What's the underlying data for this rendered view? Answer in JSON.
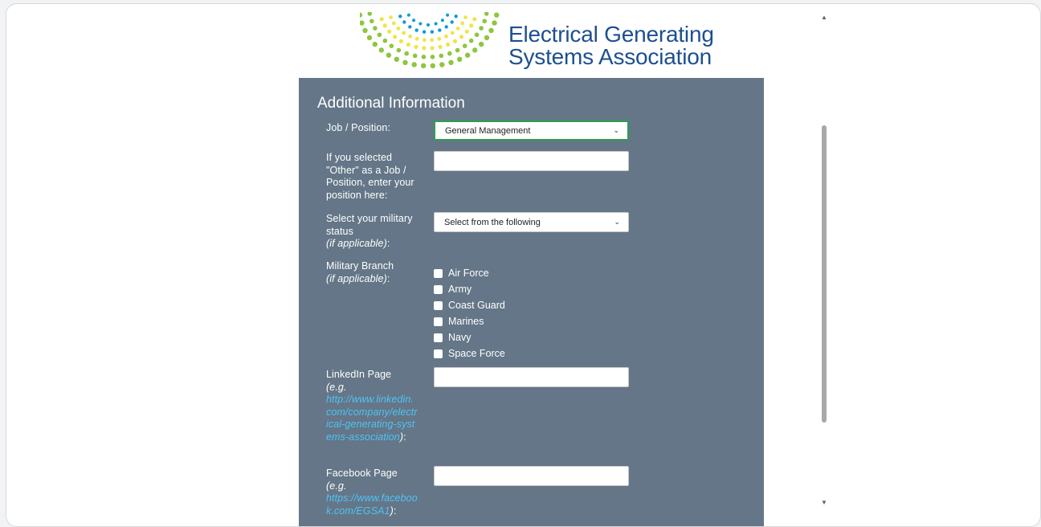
{
  "logo": {
    "line1": "Electrical Generating",
    "line2": "Systems Association",
    "brand_color": "#1d4f91",
    "dot_colors": [
      "#8dc63f",
      "#f0e44a",
      "#0f9ad7"
    ]
  },
  "panel": {
    "title": "Additional Information",
    "background": "#647687"
  },
  "job_position": {
    "label": "Job / Position:",
    "selected": "General Management"
  },
  "other_position": {
    "label": "If you selected \"Other\" as a Job / Position, enter your position here:",
    "value": ""
  },
  "military_status": {
    "label": "Select your military status",
    "note": "(if applicable)",
    "suffix": ":",
    "selected": "Select from the following"
  },
  "military_branch": {
    "label": "Military Branch",
    "note": "(if applicable)",
    "suffix": ":",
    "options": [
      "Air Force",
      "Army",
      "Coast Guard",
      "Marines",
      "Navy",
      "Space Force"
    ]
  },
  "linkedin": {
    "label": "LinkedIn Page",
    "eg": "(e.g.",
    "example_url": "http://www.linkedin.com/company/electrical-generating-systems-association",
    "close": ")",
    "suffix": ":",
    "value": ""
  },
  "facebook": {
    "label": "Facebook Page",
    "eg": "(e.g.",
    "example_url": "https://www.facebook.com/EGSA1",
    "close": ")",
    "suffix": ":",
    "value": ""
  },
  "icons": {
    "select_arrow": "chevron-down-icon",
    "scroll_up": "scroll-up-arrow-icon",
    "scroll_down": "scroll-down-arrow-icon"
  }
}
